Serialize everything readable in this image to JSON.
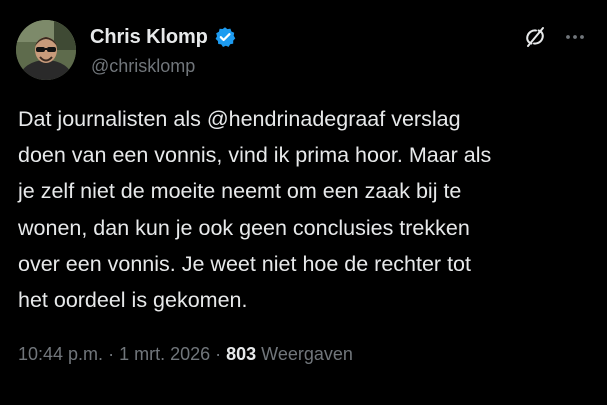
{
  "author": {
    "display_name": "Chris Klomp",
    "handle": "@chrisklomp",
    "verified": true
  },
  "tweet": {
    "text": "Dat journalisten als @hendrinadegraaf  verslag\ndoen van een vonnis, vind ik prima hoor. Maar als\nje zelf niet de moeite neemt om een zaak bij te\nwonen, dan kun je ook geen conclusies trekken\nover een vonnis. Je weet niet hoe de rechter tot\nhet oordeel is gekomen."
  },
  "meta": {
    "time": "10:44 p.m.",
    "separator_1": " · ",
    "date": "1 mrt. 2026",
    "separator_2": " · ",
    "views_count": "803",
    "views_label": " Weergaven"
  },
  "icons": {
    "grok": "grok-icon",
    "more": "more-icon",
    "verified": "verified-badge-icon"
  },
  "colors": {
    "background": "#000000",
    "text_primary": "#e7e9ea",
    "text_secondary": "#71767b",
    "verified_blue": "#1d9bf0"
  }
}
